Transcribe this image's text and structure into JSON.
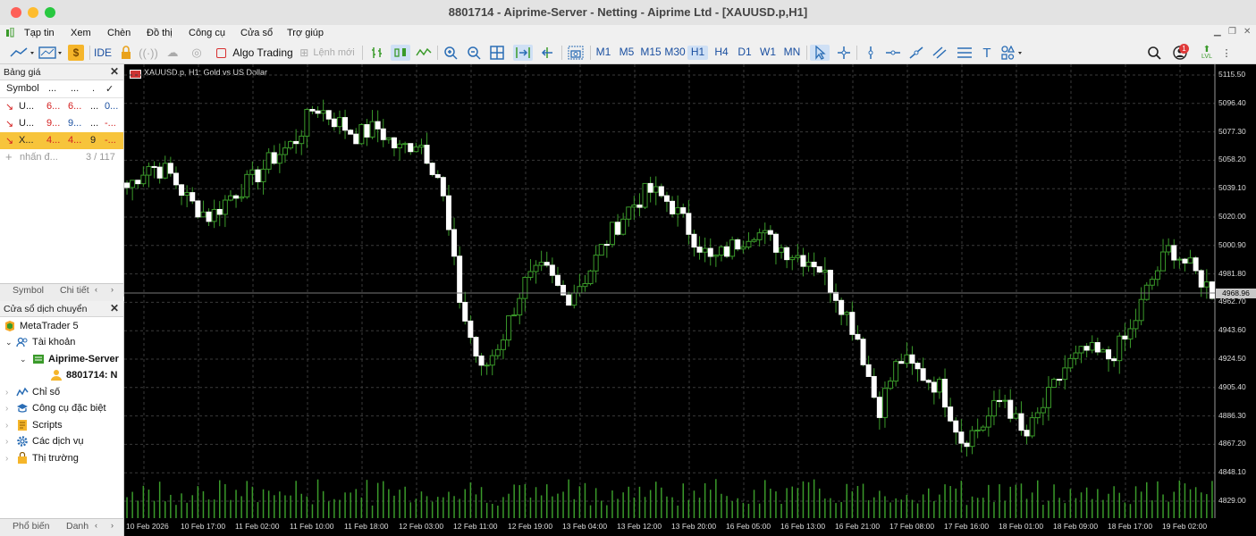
{
  "window": {
    "title": "8801714 - Aiprime-Server - Netting - Aiprime Ltd - [XAUUSD.p,H1]"
  },
  "menu": [
    "Tạp tin",
    "Xem",
    "Chèn",
    "Đồ thị",
    "Công cụ",
    "Cửa sổ",
    "Trợ giúp"
  ],
  "toolbar": {
    "ide_label": "IDE",
    "algo_label": "Algo Trading",
    "new_order_label": "Lệnh mới",
    "timeframes": [
      "M1",
      "M5",
      "M15",
      "M30",
      "H1",
      "H4",
      "D1",
      "W1",
      "MN"
    ],
    "active_timeframe": "H1",
    "notification_count": "1",
    "lvl_label": "LVL"
  },
  "market_watch": {
    "title": "Bảng giá",
    "headers": [
      "Symbol",
      "...",
      "...",
      ".",
      "✓"
    ],
    "rows": [
      {
        "symbol": "U...",
        "bid": "6...",
        "ask": "6...",
        "spread": "...",
        "chg": "0...",
        "color": "#d42020",
        "highlight": false
      },
      {
        "symbol": "U...",
        "bid": "9...",
        "ask": "9...",
        "spread": "...",
        "chg": "-...",
        "color": "#d42020",
        "highlight": false
      },
      {
        "symbol": "X...",
        "bid": "4...",
        "ask": "4...",
        "spread": "9",
        "chg": "-...",
        "color": "#d42020",
        "highlight": true
      }
    ],
    "add_label": "nhấn đ...",
    "count": "3 / 117",
    "tabs": [
      "Symbol",
      "Chi tiết"
    ]
  },
  "navigator": {
    "title": "Cửa sổ dịch chuyển",
    "items": [
      "MetaTrader 5",
      "Tài khoản",
      "Aiprime-Server",
      "8801714: N",
      "Chỉ số",
      "Công cụ đặc biệt",
      "Scripts",
      "Các dịch vụ",
      "Thị trường"
    ],
    "tabs": [
      "Phổ biến",
      "Danh"
    ]
  },
  "chart": {
    "title": "XAUUSD.p, H1:  Gold vs US Dollar",
    "current_price": "4968.96",
    "candle_up_color": "#000000",
    "candle_down_color": "#ffffff",
    "wick_color": "#3a9a2a"
  },
  "chart_data": {
    "type": "candlestick",
    "title": "XAUUSD.p, H1:  Gold vs US Dollar",
    "y_ticks": [
      "5115.50",
      "5096.40",
      "5077.30",
      "5058.20",
      "5039.10",
      "5020.00",
      "5000.90",
      "4981.80",
      "4962.70",
      "4943.60",
      "4924.50",
      "4905.40",
      "4886.30",
      "4867.20",
      "4848.10",
      "4829.00"
    ],
    "ylim": [
      4829.0,
      5115.5
    ],
    "x_ticks": [
      "10 Feb 2026",
      "10 Feb 17:00",
      "11 Feb 02:00",
      "11 Feb 10:00",
      "11 Feb 18:00",
      "12 Feb 03:00",
      "12 Feb 11:00",
      "12 Feb 19:00",
      "13 Feb 04:00",
      "13 Feb 12:00",
      "13 Feb 20:00",
      "16 Feb 05:00",
      "16 Feb 13:00",
      "16 Feb 21:00",
      "17 Feb 08:00",
      "17 Feb 16:00",
      "18 Feb 01:00",
      "18 Feb 09:00",
      "18 Feb 17:00",
      "19 Feb 02:00"
    ],
    "close_anchors": [
      5040,
      5055,
      5050,
      5030,
      5020,
      5035,
      5045,
      5060,
      5070,
      5095,
      5085,
      5075,
      5080,
      5065,
      5072,
      5045,
      4960,
      4915,
      4940,
      4975,
      4985,
      4965,
      4980,
      5005,
      5025,
      5038,
      5030,
      5010,
      4990,
      5000,
      5012,
      5002,
      4995,
      4990,
      4968,
      4940,
      4890,
      4925,
      4915,
      4905,
      4870,
      4880,
      4900,
      4870,
      4895,
      4920,
      4930,
      4925,
      4940,
      4975,
      5000,
      4985,
      4970
    ],
    "current_price": 4968.96
  }
}
